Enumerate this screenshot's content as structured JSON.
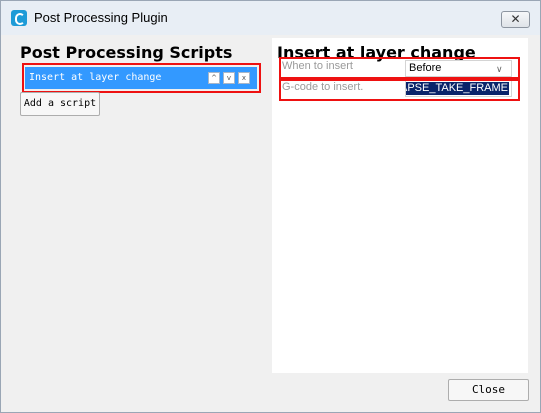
{
  "window": {
    "title": "Post Processing Plugin",
    "close_glyph": "✕"
  },
  "left": {
    "heading": "Post Processing Scripts",
    "scripts": [
      {
        "label": "Insert at layer change",
        "up_glyph": "^",
        "down_glyph": "v",
        "remove_glyph": "x"
      }
    ],
    "add_button": "Add a script"
  },
  "right": {
    "heading": "Insert at layer change",
    "when": {
      "label": "When to insert",
      "value": "Before"
    },
    "gcode": {
      "label": "G-code to insert.",
      "value": "_APSE_TAKE_FRAME"
    }
  },
  "footer": {
    "close_button": "Close"
  },
  "colors": {
    "selection": "#3399ff",
    "highlight_box": "#ee1111",
    "text_selection": "#0a246a"
  }
}
